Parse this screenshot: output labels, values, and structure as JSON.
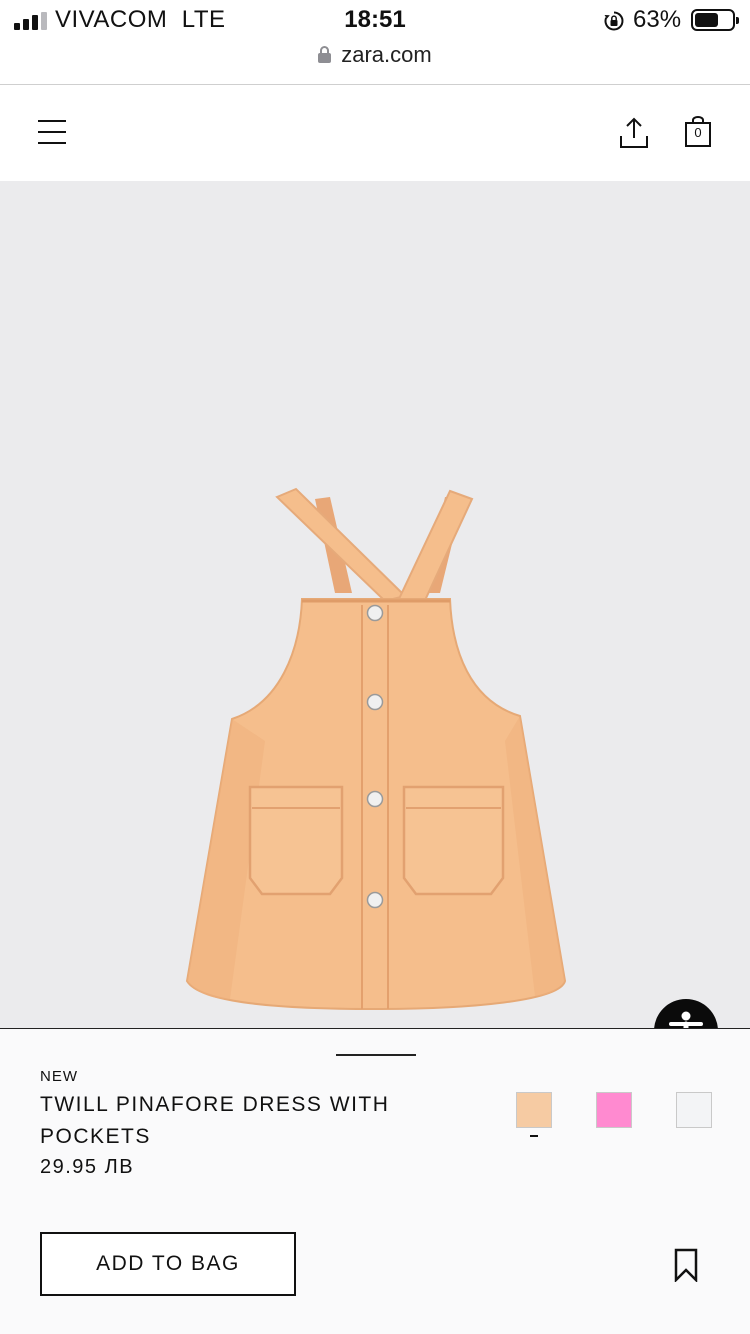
{
  "status_bar": {
    "carrier": "VIVACOM",
    "network": "LTE",
    "time": "18:51",
    "battery_percent": "63%",
    "battery_level": 0.63,
    "signal_bars": 3,
    "signal_bars_total": 4
  },
  "browser": {
    "url": "zara.com"
  },
  "header": {
    "menu_icon": "hamburger-menu-icon",
    "share_icon": "share-icon",
    "bag_icon": "shopping-bag-icon",
    "bag_count": "0"
  },
  "product": {
    "badge": "NEW",
    "name": "TWILL PINAFORE DRESS WITH POCKETS",
    "price": "29.95 ЛВ",
    "image_subject": "peach twill pinafore dress",
    "dress_color": "#f5be8c",
    "colors": [
      {
        "hex": "#f6cba3",
        "selected": true
      },
      {
        "hex": "#ff8ad0",
        "selected": false
      },
      {
        "hex": "#f3f4f6",
        "selected": false
      }
    ]
  },
  "actions": {
    "add_to_bag_label": "ADD TO BAG",
    "bookmark_icon": "bookmark-icon",
    "accessibility_icon": "accessibility-icon"
  }
}
